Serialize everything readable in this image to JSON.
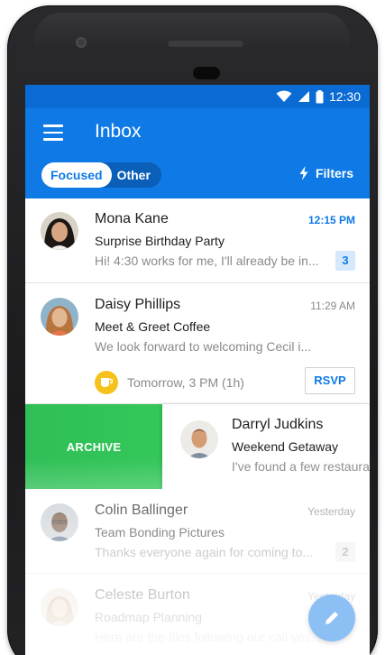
{
  "status_bar": {
    "time": "12:30"
  },
  "app_bar": {
    "title": "Inbox",
    "tabs": [
      {
        "label": "Focused"
      },
      {
        "label": "Other"
      }
    ],
    "filters_label": "Filters"
  },
  "colors": {
    "accent": "#0f7ae5",
    "status_bar": "#0a6bd4",
    "archive": "#34c759",
    "event_icon": "#f4c21a"
  },
  "messages": [
    {
      "sender": "Mona Kane",
      "subject": "Surprise Birthday Party",
      "preview": "Hi! 4:30 works for me, I'll already be in...",
      "time": "12:15 PM",
      "count": "3"
    },
    {
      "sender": "Daisy Phillips",
      "subject": "Meet & Greet Coffee",
      "preview": "We look forward to welcoming Cecil i...",
      "time": "11:29 AM",
      "event_text": "Tomorrow, 3 PM (1h)",
      "rsvp_label": "RSVP"
    },
    {
      "sender": "Darryl Judkins",
      "subject": "Weekend Getaway",
      "preview": "I've found a few restaurants",
      "swipe_action": "ARCHIVE"
    },
    {
      "sender": "Colin Ballinger",
      "subject": "Team Bonding Pictures",
      "preview": "Thanks everyone again for coming to...",
      "time": "Yesterday",
      "count": "2"
    },
    {
      "sender": "Celeste Burton",
      "subject": "Roadmap Planning",
      "preview": "Here are the files following our call yes...",
      "time": "Yesterday"
    }
  ]
}
